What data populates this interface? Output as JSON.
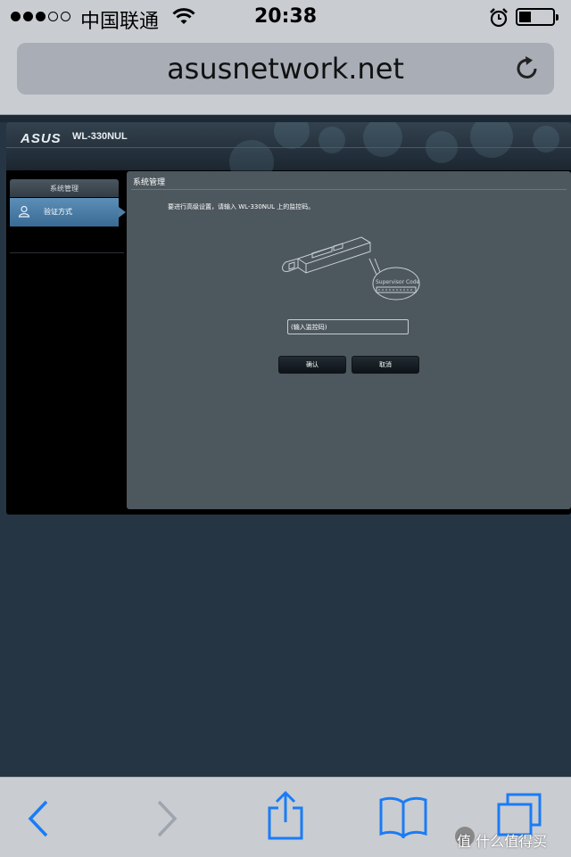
{
  "status_bar": {
    "carrier": "中国联通",
    "time": "20:38",
    "signal_bars_filled": 3,
    "signal_bars_total": 5,
    "battery_level": 0.35
  },
  "browser": {
    "url": "asusnetwork.net"
  },
  "router": {
    "brand": "ASUS",
    "model": "WL-330NUL",
    "sidebar": {
      "section_title": "系统管理",
      "items": [
        {
          "label": "验证方式",
          "icon": "user-icon",
          "active": true
        }
      ]
    },
    "panel": {
      "title": "系统管理",
      "instruction": "要进行高级设置，请输入 WL-330NUL 上的监控码。",
      "illustration_label": "Supervisor Code",
      "code_input_value": "(输入监控码)",
      "confirm_label": "确认",
      "cancel_label": "取消"
    }
  },
  "toolbar": {
    "icons": [
      "back-icon",
      "forward-icon",
      "share-icon",
      "bookmarks-icon",
      "tabs-icon"
    ]
  },
  "watermark": {
    "text": "值 什么值得买"
  },
  "colors": {
    "ios_accent": "#1a7cf5",
    "panel_bg": "#4d575e",
    "sidebar_active": "#4f7fa6"
  }
}
